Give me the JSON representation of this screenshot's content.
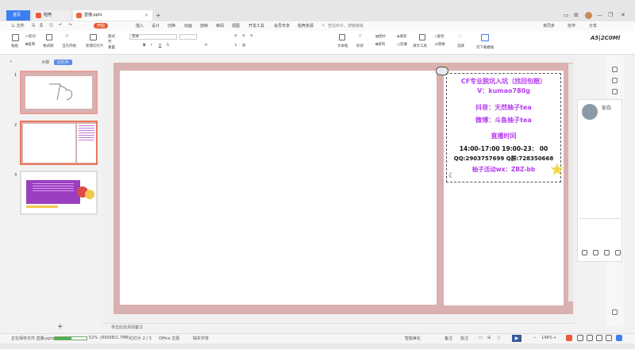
{
  "titlebar": {
    "tab_home": "首页",
    "tab_templates": "稻壳",
    "tab_doc": "直播.pptx",
    "add_tab": "+"
  },
  "menu": {
    "items": [
      "三 文件",
      "开始",
      "插入",
      "设计",
      "切换",
      "动画",
      "放映",
      "审阅",
      "视图",
      "开发工具",
      "会员专享",
      "稻壳资源"
    ],
    "file": "三 文件",
    "active": "开始",
    "search_placeholder": "查找命令、搜索模板",
    "share": "未同步",
    "collab": "协作",
    "share2": "分享"
  },
  "ribbon": {
    "paste": "粘贴",
    "cut": "剪切",
    "copy": "复制",
    "format_painter": "格式刷",
    "from_start": "当页开始",
    "new_slide": "新建幻灯片",
    "layout": "版式",
    "section": "节",
    "reset": "重置",
    "font_name": "黑体",
    "text_box": "文本框",
    "shape": "形状",
    "arrange": "排列",
    "picture": "图片",
    "fill": "填充",
    "outline": "轮廓",
    "find": "查找",
    "replace": "替换",
    "select": "选择",
    "presentation_tools": "演示工具",
    "template": "可下载模板",
    "brand": "A5|2C0Ml"
  },
  "leftpanel": {
    "tab_outline": "大纲",
    "tab_slides": "幻灯片",
    "slides": [
      "1",
      "2",
      "3"
    ],
    "add": "+"
  },
  "slide": {
    "info_lines": [
      {
        "text": "CF专业脱坑入坑（找回包赔）",
        "color": "purple"
      },
      {
        "text": "V：kumao780g",
        "color": "purple"
      },
      {
        "text": "抖音：天然柚子tea",
        "color": "purple"
      },
      {
        "text": "微博：斗鱼柚子tea",
        "color": "purple"
      },
      {
        "text": "直播时间",
        "color": "purple"
      },
      {
        "text": "14:00-17:00  19:00-23： 00",
        "color": "black"
      },
      {
        "text": "QQ:2903757699 Q群:728350668",
        "color": "black"
      },
      {
        "text": "柚子活动wx：ZBZ-bb",
        "color": "purple"
      }
    ]
  },
  "notes": {
    "placeholder": "单击此处添加备注"
  },
  "chat": {
    "name": "安白"
  },
  "status": {
    "saving": "正在保存文件 直播.pptx",
    "progress_percent": 52,
    "progress_label": "52%",
    "size_info": "(895KB/1.7MB)",
    "slide_info": "幻灯片 2 / 3",
    "theme": "Office 主题",
    "missing_font": "缺失字体",
    "smart": "智能美化",
    "notes": "备注",
    "comment": "批注",
    "zoom": "148%",
    "minus": "−",
    "plus": "+"
  },
  "colors": {
    "accent": "#3d7ff0",
    "menu_active": "#e85d3a",
    "slide_bg": "#d9b1b0",
    "info_purple": "#b43cf0"
  }
}
